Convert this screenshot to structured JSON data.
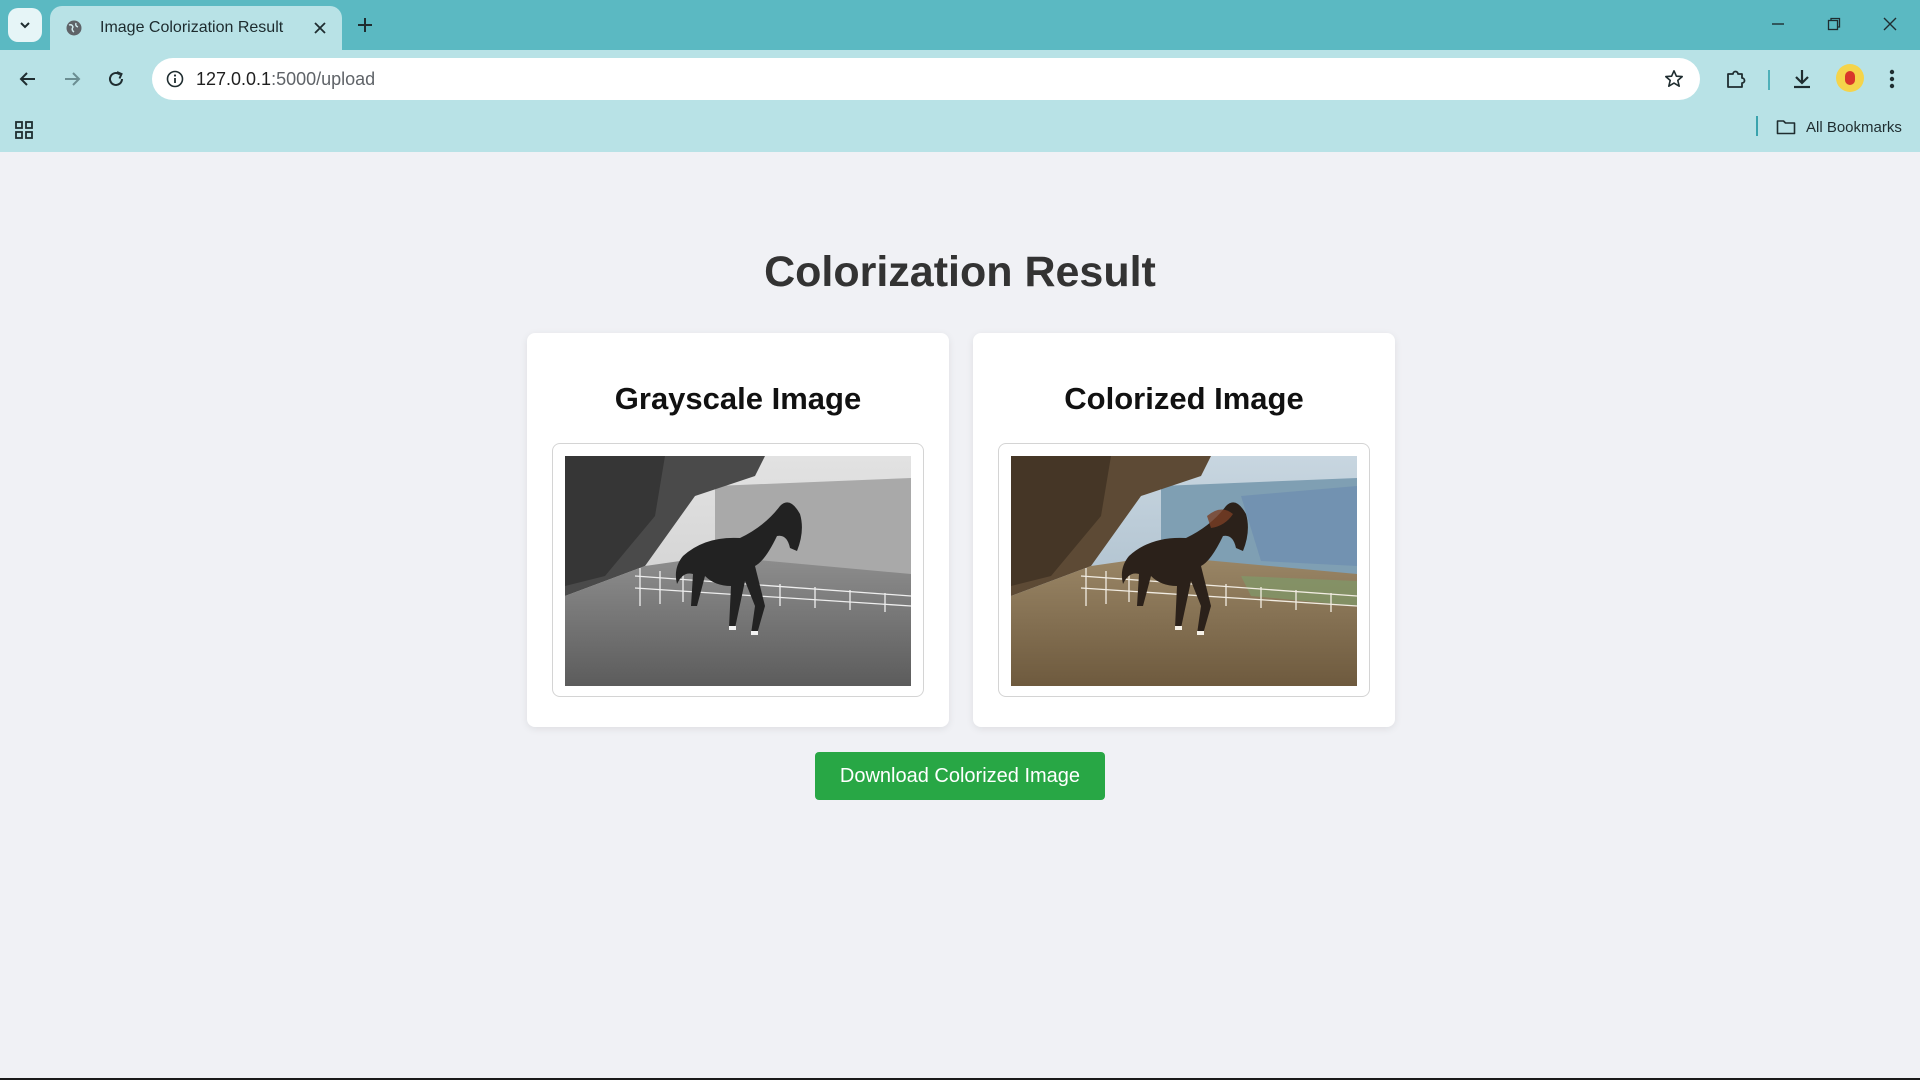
{
  "browser": {
    "tab_title": "Image Colorization Result",
    "url_host": "127.0.0.1",
    "url_path": ":5000/upload",
    "bookmarks_label": "All Bookmarks"
  },
  "icons": {
    "tab_search": "chevron-down-icon",
    "favicon": "globe-icon",
    "tab_close": "close-icon",
    "new_tab": "plus-icon",
    "minimize": "minimize-icon",
    "restore": "restore-icon",
    "close_window": "close-icon",
    "back": "arrow-left-icon",
    "forward": "arrow-right-icon",
    "reload": "reload-icon",
    "site_info": "info-icon",
    "bookmark_star": "star-icon",
    "extensions": "puzzle-icon",
    "downloads": "download-icon",
    "menu": "kebab-menu-icon",
    "apps": "apps-grid-icon",
    "folder": "folder-icon"
  },
  "page": {
    "title": "Colorization Result",
    "grayscale_card_title": "Grayscale Image",
    "colorized_card_title": "Colorized Image",
    "download_label": "Download Colorized Image"
  },
  "colors": {
    "tabstrip": "#5bb9c2",
    "toolbar": "#b8e2e6",
    "page_background": "#f0f1f5",
    "download_button": "#28a745"
  }
}
